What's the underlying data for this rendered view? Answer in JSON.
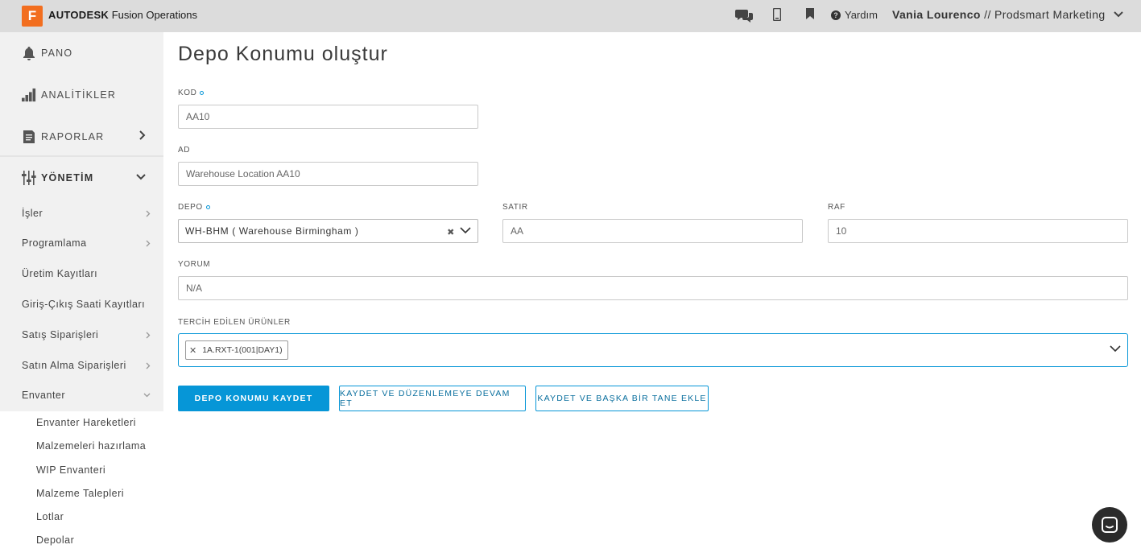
{
  "header": {
    "logo_letter": "F",
    "brand_bold": "AUTODESK",
    "brand_rest": " Fusion Operations",
    "icons": [
      "chat-icon",
      "mobile-icon",
      "bookmark-icon",
      "help-icon"
    ],
    "help_label": "Yardım",
    "user_name": "Vania Lourenco",
    "user_sep": " // ",
    "org_name": "Prodsmart Marketing",
    "bar_color": "#dcdcdc",
    "logo_color": "#f26e1f"
  },
  "sidebar": {
    "main_items": [
      {
        "label": "PANO",
        "icon": "bell-icon"
      },
      {
        "label": "ANALİTİKLER",
        "icon": "bar-chart-icon"
      },
      {
        "label": "RAPORLAR",
        "icon": "report-icon"
      },
      {
        "label": "YÖNETİM",
        "icon": "sliders-icon"
      }
    ],
    "sub_items": [
      {
        "label": "İşler"
      },
      {
        "label": "Programlama"
      },
      {
        "label": "Üretim Kayıtları"
      },
      {
        "label": "Giriş-Çıkış Saati Kayıtları"
      },
      {
        "label": "Satış Siparişleri"
      },
      {
        "label": "Satın Alma Siparişleri"
      },
      {
        "label": "Envanter"
      }
    ],
    "inventory_items": [
      {
        "label": "Envanter Hareketleri"
      },
      {
        "label": "Malzemeleri hazırlama"
      },
      {
        "label": "WIP Envanteri"
      },
      {
        "label": "Malzeme Talepleri"
      },
      {
        "label": "Lotlar"
      },
      {
        "label": "Depolar"
      }
    ]
  },
  "form": {
    "title": "Depo Konumu oluştur",
    "code_label": "KOD",
    "code_value": "AA10",
    "name_label": "AD",
    "name_value": "Warehouse Location AA10",
    "warehouse_label": "DEPO",
    "warehouse_value": "WH-BHM ( Warehouse Birmingham )",
    "row_label": "SATIR",
    "row_value": "AA",
    "shelf_label": "RAF",
    "shelf_value": "10",
    "comment_label": "YORUM",
    "comment_value": "N/A",
    "preferred_label": "TERCİH EDİLEN ÜRÜNLER",
    "preferred_items": [
      "1A.RXT-1(001|DAY1)"
    ]
  },
  "buttons": {
    "save": "DEPO KONUMU KAYDET",
    "save_continue": "KAYDET VE DÜZENLEMEYE DEVAM ET",
    "save_add": "KAYDET VE BAŞKA BİR TANE EKLE",
    "primary_color": "#0696d7"
  }
}
